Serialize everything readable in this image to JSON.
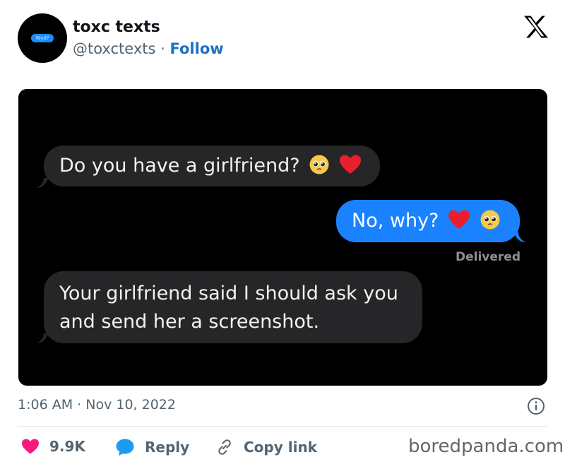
{
  "author": {
    "name": "toxc texts",
    "handle": "@toxctexts",
    "separator": "·",
    "follow_label": "Follow",
    "avatar_text": "Wyd?"
  },
  "platform_icon": "x-logo-icon",
  "messages": [
    {
      "direction": "incoming",
      "text": "Do you have a girlfriend?",
      "emojis": [
        "pleading-face",
        "red-heart"
      ]
    },
    {
      "direction": "outgoing",
      "text": "No, why?",
      "emojis": [
        "red-heart",
        "pleading-face"
      ]
    },
    {
      "direction": "incoming",
      "text_line1": "Your girlfriend said I should ask you",
      "text_line2": "and send her a screenshot."
    }
  ],
  "delivered_label": "Delivered",
  "meta": {
    "time": "1:06 AM",
    "separator": "·",
    "date": "Nov 10, 2022"
  },
  "actions": {
    "like_count": "9.9K",
    "reply_label": "Reply",
    "copy_label": "Copy link"
  },
  "watermark": "boredpanda.com",
  "colors": {
    "follow": "#1d6fc4",
    "incoming_bubble": "#262628",
    "outgoing_bubble": "#1a82ff",
    "like": "#f91880",
    "reply": "#1d9bf0"
  }
}
